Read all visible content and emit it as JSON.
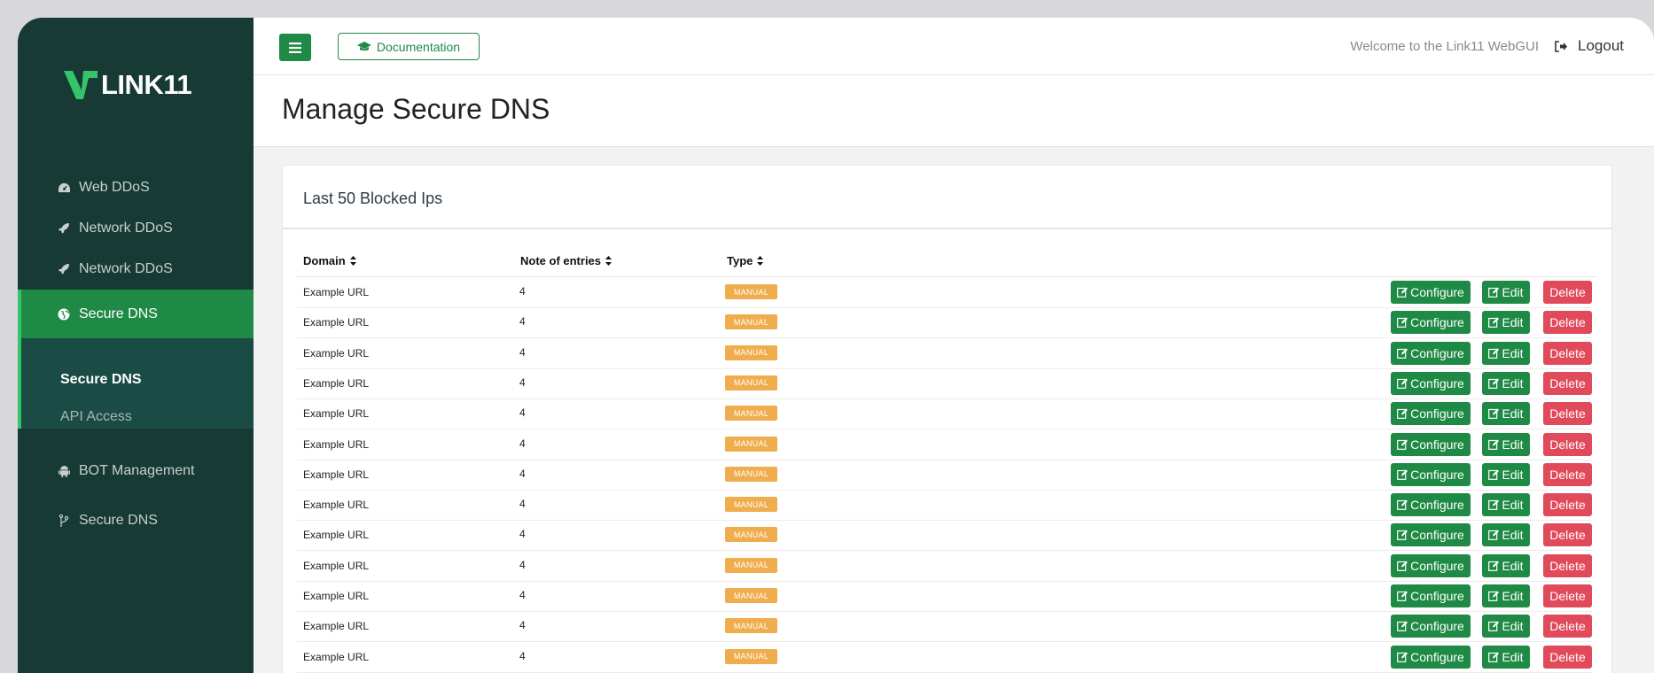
{
  "brand": {
    "logo_text": "LINK11"
  },
  "topbar": {
    "documentation_label": "Documentation",
    "welcome_text": "Welcome to the Link11 WebGUI",
    "logout_label": "Logout"
  },
  "sidebar": {
    "items": [
      {
        "label": "Web DDoS",
        "icon": "dashboard-icon"
      },
      {
        "label": "Network DDoS",
        "icon": "rocket-icon"
      },
      {
        "label": "Network DDoS",
        "icon": "rocket-icon"
      },
      {
        "label": "Secure DNS",
        "icon": "globe-icon",
        "active": true
      },
      {
        "label": "BOT Management",
        "icon": "android-icon"
      },
      {
        "label": "Secure DNS",
        "icon": "branch-icon"
      }
    ],
    "submenu": [
      {
        "label": "Secure DNS",
        "active": true
      },
      {
        "label": "API Access"
      }
    ]
  },
  "page": {
    "title": "Manage Secure DNS"
  },
  "card": {
    "title": "Last 50 Blocked Ips",
    "columns": [
      "Domain",
      "Note of entries",
      "Type"
    ],
    "actions": {
      "configure": "Configure",
      "edit": "Edit",
      "delete": "Delete"
    },
    "rows": [
      {
        "domain": "Example URL",
        "count": "4",
        "type": "MANUAL"
      },
      {
        "domain": "Example URL",
        "count": "4",
        "type": "MANUAL"
      },
      {
        "domain": "Example URL",
        "count": "4",
        "type": "MANUAL"
      },
      {
        "domain": "Example URL",
        "count": "4",
        "type": "MANUAL"
      },
      {
        "domain": "Example URL",
        "count": "4",
        "type": "MANUAL"
      },
      {
        "domain": "Example URL",
        "count": "4",
        "type": "MANUAL"
      },
      {
        "domain": "Example URL",
        "count": "4",
        "type": "MANUAL"
      },
      {
        "domain": "Example URL",
        "count": "4",
        "type": "MANUAL"
      },
      {
        "domain": "Example URL",
        "count": "4",
        "type": "MANUAL"
      },
      {
        "domain": "Example URL",
        "count": "4",
        "type": "MANUAL"
      },
      {
        "domain": "Example URL",
        "count": "4",
        "type": "MANUAL"
      },
      {
        "domain": "Example URL",
        "count": "4",
        "type": "MANUAL"
      },
      {
        "domain": "Example URL",
        "count": "4",
        "type": "MANUAL"
      }
    ]
  },
  "colors": {
    "sidebar_bg": "#173a35",
    "accent_green": "#1f8a45",
    "badge_orange": "#f0ad4e",
    "delete_red": "#e14a5a"
  }
}
